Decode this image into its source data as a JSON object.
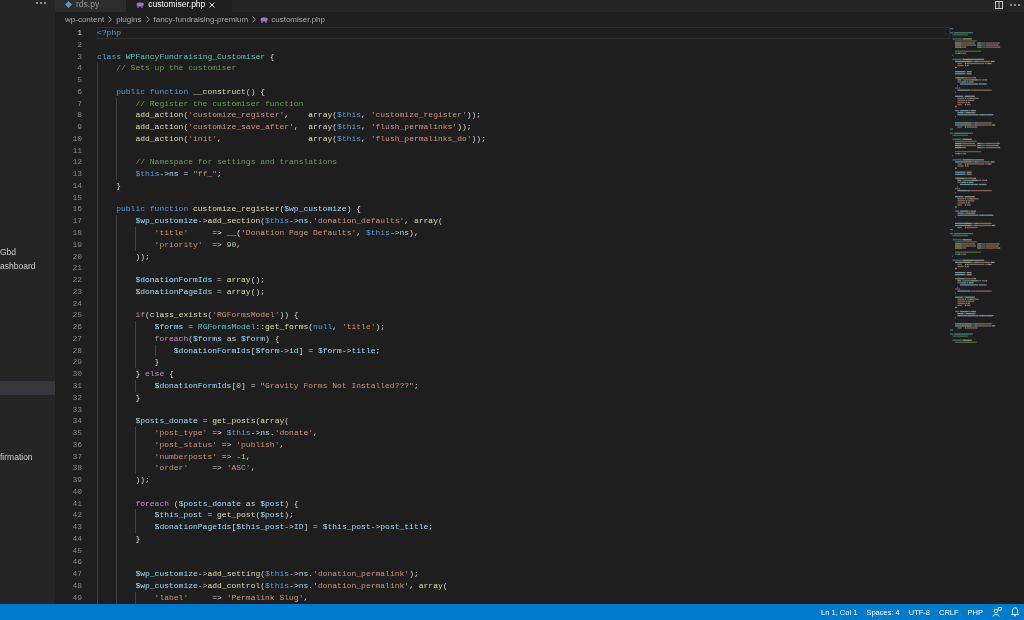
{
  "sidebar": {
    "items": [
      {
        "label": "Gbd",
        "selected": false
      },
      {
        "label": "ashboard",
        "selected": false
      },
      {
        "selected": true
      },
      {
        "label": "firmation",
        "selected": false
      }
    ]
  },
  "tabs": [
    {
      "label": "rds.py",
      "kind": "python",
      "selected": false
    },
    {
      "label": "customiser.php",
      "kind": "php",
      "selected": true
    }
  ],
  "breadcrumbs": [
    {
      "label": "wp-content",
      "kind": "folder"
    },
    {
      "label": "plugins",
      "kind": "folder"
    },
    {
      "label": "fancy-fundraising-premium",
      "kind": "folder"
    },
    {
      "label": "customiser.php",
      "kind": "php"
    }
  ],
  "editor": {
    "lines": [
      {
        "number": "1",
        "active": true,
        "tokens": [
          {
            "kind": "keyword",
            "text": "<?php"
          }
        ]
      },
      {
        "number": "2",
        "active": false
      },
      {
        "number": "3",
        "active": false,
        "tokens": [
          {
            "kind": "keyword",
            "text": "class "
          },
          {
            "kind": "class",
            "text": "WPFancyFundraising_Customiser"
          },
          {
            "kind": "plain",
            "text": " {"
          }
        ]
      },
      {
        "number": "4",
        "active": false,
        "tokens": [
          {
            "kind": "comment",
            "text": "    // Sets up the customiser"
          }
        ]
      },
      {
        "number": "5",
        "active": false
      },
      {
        "number": "6",
        "active": false,
        "tokens": [
          {
            "kind": "keyword",
            "text": "    public function "
          },
          {
            "kind": "function",
            "text": "__construct"
          },
          {
            "kind": "plain",
            "text": "() {"
          }
        ]
      },
      {
        "number": "7",
        "active": false,
        "tokens": [
          {
            "kind": "comment",
            "text": "        // Register the customiser function"
          }
        ]
      },
      {
        "number": "8",
        "active": false,
        "tokens": [
          {
            "kind": "function",
            "text": "        add_action"
          },
          {
            "kind": "plain",
            "text": "("
          },
          {
            "kind": "string",
            "text": "'customize_register'"
          },
          {
            "kind": "plain",
            "text": ",    "
          },
          {
            "kind": "function",
            "text": "array"
          },
          {
            "kind": "plain",
            "text": "("
          },
          {
            "kind": "keyword",
            "text": "$this"
          },
          {
            "kind": "plain",
            "text": ", "
          },
          {
            "kind": "string",
            "text": "'customize_register'"
          },
          {
            "kind": "plain",
            "text": "));"
          }
        ]
      },
      {
        "number": "9",
        "active": false,
        "tokens": [
          {
            "kind": "function",
            "text": "        add_action"
          },
          {
            "kind": "plain",
            "text": "("
          },
          {
            "kind": "string",
            "text": "'customize_save_after'"
          },
          {
            "kind": "plain",
            "text": ",  "
          },
          {
            "kind": "function",
            "text": "array"
          },
          {
            "kind": "plain",
            "text": "("
          },
          {
            "kind": "keyword",
            "text": "$this"
          },
          {
            "kind": "plain",
            "text": ", "
          },
          {
            "kind": "string",
            "text": "'flush_permalinks'"
          },
          {
            "kind": "plain",
            "text": "));"
          }
        ]
      },
      {
        "number": "10",
        "active": false,
        "tokens": [
          {
            "kind": "function",
            "text": "        add_action"
          },
          {
            "kind": "plain",
            "text": "("
          },
          {
            "kind": "string",
            "text": "'init'"
          },
          {
            "kind": "plain",
            "text": ",                  "
          },
          {
            "kind": "function",
            "text": "array"
          },
          {
            "kind": "plain",
            "text": "("
          },
          {
            "kind": "keyword",
            "text": "$this"
          },
          {
            "kind": "plain",
            "text": ", "
          },
          {
            "kind": "string",
            "text": "'flush_permalinks_do'"
          },
          {
            "kind": "plain",
            "text": "));"
          }
        ]
      },
      {
        "number": "11",
        "active": false
      },
      {
        "number": "12",
        "active": false,
        "tokens": [
          {
            "kind": "comment",
            "text": "        // Namespace for settings and translations"
          }
        ]
      },
      {
        "number": "13",
        "active": false,
        "tokens": [
          {
            "kind": "keyword",
            "text": "        $this"
          },
          {
            "kind": "plain",
            "text": "->"
          },
          {
            "kind": "variable",
            "text": "ns"
          },
          {
            "kind": "plain",
            "text": " = "
          },
          {
            "kind": "string",
            "text": "\"ff_\""
          },
          {
            "kind": "plain",
            "text": ";"
          }
        ]
      },
      {
        "number": "14",
        "active": false,
        "tokens": [
          {
            "kind": "plain",
            "text": "    }"
          }
        ]
      },
      {
        "number": "15",
        "active": false
      },
      {
        "number": "16",
        "active": false,
        "tokens": [
          {
            "kind": "keyword",
            "text": "    public function "
          },
          {
            "kind": "function",
            "text": "customize_register"
          },
          {
            "kind": "plain",
            "text": "("
          },
          {
            "kind": "variable",
            "text": "$wp_customize"
          },
          {
            "kind": "plain",
            "text": ") {"
          }
        ]
      },
      {
        "number": "17",
        "active": false,
        "tokens": [
          {
            "kind": "variable",
            "text": "        $wp_customize"
          },
          {
            "kind": "plain",
            "text": "->"
          },
          {
            "kind": "function",
            "text": "add_section"
          },
          {
            "kind": "plain",
            "text": "("
          },
          {
            "kind": "keyword",
            "text": "$this"
          },
          {
            "kind": "plain",
            "text": "->"
          },
          {
            "kind": "variable",
            "text": "ns"
          },
          {
            "kind": "plain",
            "text": "."
          },
          {
            "kind": "string",
            "text": "'donation_defaults'"
          },
          {
            "kind": "plain",
            "text": ", "
          },
          {
            "kind": "function",
            "text": "array"
          },
          {
            "kind": "plain",
            "text": "("
          }
        ]
      },
      {
        "number": "18",
        "active": false,
        "tokens": [
          {
            "kind": "string",
            "text": "            'title'"
          },
          {
            "kind": "plain",
            "text": "     => "
          },
          {
            "kind": "function",
            "text": "__"
          },
          {
            "kind": "plain",
            "text": "("
          },
          {
            "kind": "string",
            "text": "'Donation Page Defaults'"
          },
          {
            "kind": "plain",
            "text": ", "
          },
          {
            "kind": "keyword",
            "text": "$this"
          },
          {
            "kind": "plain",
            "text": "->"
          },
          {
            "kind": "variable",
            "text": "ns"
          },
          {
            "kind": "plain",
            "text": "),"
          }
        ]
      },
      {
        "number": "19",
        "active": false,
        "tokens": [
          {
            "kind": "string",
            "text": "            'priority'"
          },
          {
            "kind": "plain",
            "text": "  => "
          },
          {
            "kind": "number",
            "text": "90"
          },
          {
            "kind": "plain",
            "text": ","
          }
        ]
      },
      {
        "number": "20",
        "active": false,
        "tokens": [
          {
            "kind": "plain",
            "text": "        ));"
          }
        ]
      },
      {
        "number": "21",
        "active": false
      },
      {
        "number": "22",
        "active": false,
        "tokens": [
          {
            "kind": "variable",
            "text": "        $donationFormIds"
          },
          {
            "kind": "plain",
            "text": " = "
          },
          {
            "kind": "function",
            "text": "array"
          },
          {
            "kind": "plain",
            "text": "();"
          }
        ]
      },
      {
        "number": "23",
        "active": false,
        "tokens": [
          {
            "kind": "variable",
            "text": "        $donationPageIds"
          },
          {
            "kind": "plain",
            "text": " = "
          },
          {
            "kind": "function",
            "text": "array"
          },
          {
            "kind": "plain",
            "text": "();"
          }
        ]
      },
      {
        "number": "24",
        "active": false
      },
      {
        "number": "25",
        "active": false,
        "tokens": [
          {
            "kind": "control",
            "text": "        if"
          },
          {
            "kind": "plain",
            "text": "("
          },
          {
            "kind": "function",
            "text": "class_exists"
          },
          {
            "kind": "plain",
            "text": "("
          },
          {
            "kind": "string",
            "text": "'RGFormsModel'"
          },
          {
            "kind": "plain",
            "text": ")) {"
          }
        ]
      },
      {
        "number": "26",
        "active": false,
        "tokens": [
          {
            "kind": "variable",
            "text": "            $forms"
          },
          {
            "kind": "plain",
            "text": " = "
          },
          {
            "kind": "class",
            "text": "RGFormsModel"
          },
          {
            "kind": "plain",
            "text": "::"
          },
          {
            "kind": "function",
            "text": "get_forms"
          },
          {
            "kind": "plain",
            "text": "("
          },
          {
            "kind": "keyword",
            "text": "null"
          },
          {
            "kind": "plain",
            "text": ", "
          },
          {
            "kind": "string",
            "text": "'title'"
          },
          {
            "kind": "plain",
            "text": ");"
          }
        ]
      },
      {
        "number": "27",
        "active": false,
        "tokens": [
          {
            "kind": "control",
            "text": "            foreach"
          },
          {
            "kind": "plain",
            "text": "("
          },
          {
            "kind": "variable",
            "text": "$forms"
          },
          {
            "kind": "plain",
            "text": " as "
          },
          {
            "kind": "variable",
            "text": "$form"
          },
          {
            "kind": "plain",
            "text": ") {"
          }
        ]
      },
      {
        "number": "28",
        "active": false,
        "tokens": [
          {
            "kind": "variable",
            "text": "                $donationFormIds"
          },
          {
            "kind": "plain",
            "text": "["
          },
          {
            "kind": "variable",
            "text": "$form"
          },
          {
            "kind": "plain",
            "text": "->"
          },
          {
            "kind": "variable",
            "text": "id"
          },
          {
            "kind": "plain",
            "text": "] = "
          },
          {
            "kind": "variable",
            "text": "$form"
          },
          {
            "kind": "plain",
            "text": "->"
          },
          {
            "kind": "variable",
            "text": "title"
          },
          {
            "kind": "plain",
            "text": ";"
          }
        ]
      },
      {
        "number": "29",
        "active": false,
        "tokens": [
          {
            "kind": "plain",
            "text": "            }"
          }
        ]
      },
      {
        "number": "30",
        "active": false,
        "tokens": [
          {
            "kind": "plain",
            "text": "        } "
          },
          {
            "kind": "control",
            "text": "else"
          },
          {
            "kind": "plain",
            "text": " {"
          }
        ]
      },
      {
        "number": "31",
        "active": false,
        "tokens": [
          {
            "kind": "variable",
            "text": "            $donationFormIds"
          },
          {
            "kind": "plain",
            "text": "["
          },
          {
            "kind": "number",
            "text": "0"
          },
          {
            "kind": "plain",
            "text": "] = "
          },
          {
            "kind": "string",
            "text": "\"Gravity Forms Not Installed???\""
          },
          {
            "kind": "plain",
            "text": ";"
          }
        ]
      },
      {
        "number": "32",
        "active": false,
        "tokens": [
          {
            "kind": "plain",
            "text": "        }"
          }
        ]
      },
      {
        "number": "33",
        "active": false
      },
      {
        "number": "34",
        "active": false,
        "tokens": [
          {
            "kind": "variable",
            "text": "        $posts_donate"
          },
          {
            "kind": "plain",
            "text": " = "
          },
          {
            "kind": "function",
            "text": "get_posts"
          },
          {
            "kind": "plain",
            "text": "("
          },
          {
            "kind": "function",
            "text": "array"
          },
          {
            "kind": "plain",
            "text": "("
          }
        ]
      },
      {
        "number": "35",
        "active": false,
        "tokens": [
          {
            "kind": "string",
            "text": "            'post_type'"
          },
          {
            "kind": "plain",
            "text": " => "
          },
          {
            "kind": "keyword",
            "text": "$this"
          },
          {
            "kind": "plain",
            "text": "->"
          },
          {
            "kind": "variable",
            "text": "ns"
          },
          {
            "kind": "plain",
            "text": "."
          },
          {
            "kind": "string",
            "text": "'donate'"
          },
          {
            "kind": "plain",
            "text": ","
          }
        ]
      },
      {
        "number": "36",
        "active": false,
        "tokens": [
          {
            "kind": "string",
            "text": "            'post_status'"
          },
          {
            "kind": "plain",
            "text": " => "
          },
          {
            "kind": "string",
            "text": "'publish'"
          },
          {
            "kind": "plain",
            "text": ","
          }
        ]
      },
      {
        "number": "37",
        "active": false,
        "tokens": [
          {
            "kind": "string",
            "text": "            'numberposts'"
          },
          {
            "kind": "plain",
            "text": " => "
          },
          {
            "kind": "number",
            "text": "-1"
          },
          {
            "kind": "plain",
            "text": ","
          }
        ]
      },
      {
        "number": "38",
        "active": false,
        "tokens": [
          {
            "kind": "string",
            "text": "            'order'"
          },
          {
            "kind": "plain",
            "text": "     => "
          },
          {
            "kind": "string",
            "text": "'ASC'"
          },
          {
            "kind": "plain",
            "text": ","
          }
        ]
      },
      {
        "number": "39",
        "active": false,
        "tokens": [
          {
            "kind": "plain",
            "text": "        ));"
          }
        ]
      },
      {
        "number": "40",
        "active": false
      },
      {
        "number": "41",
        "active": false,
        "tokens": [
          {
            "kind": "control",
            "text": "        foreach"
          },
          {
            "kind": "plain",
            "text": " ("
          },
          {
            "kind": "variable",
            "text": "$posts_donate"
          },
          {
            "kind": "plain",
            "text": " as "
          },
          {
            "kind": "variable",
            "text": "$post"
          },
          {
            "kind": "plain",
            "text": ") {"
          }
        ]
      },
      {
        "number": "42",
        "active": false,
        "tokens": [
          {
            "kind": "variable",
            "text": "            $this_post"
          },
          {
            "kind": "plain",
            "text": " = "
          },
          {
            "kind": "function",
            "text": "get_post"
          },
          {
            "kind": "plain",
            "text": "("
          },
          {
            "kind": "variable",
            "text": "$post"
          },
          {
            "kind": "plain",
            "text": ");"
          }
        ]
      },
      {
        "number": "43",
        "active": false,
        "tokens": [
          {
            "kind": "variable",
            "text": "            $donationPageIds"
          },
          {
            "kind": "plain",
            "text": "["
          },
          {
            "kind": "variable",
            "text": "$this_post"
          },
          {
            "kind": "plain",
            "text": "->"
          },
          {
            "kind": "variable",
            "text": "ID"
          },
          {
            "kind": "plain",
            "text": "] = "
          },
          {
            "kind": "variable",
            "text": "$this_post"
          },
          {
            "kind": "plain",
            "text": "->"
          },
          {
            "kind": "variable",
            "text": "post_title"
          },
          {
            "kind": "plain",
            "text": ";"
          }
        ]
      },
      {
        "number": "44",
        "active": false,
        "tokens": [
          {
            "kind": "plain",
            "text": "        }"
          }
        ]
      },
      {
        "number": "45",
        "active": false
      },
      {
        "number": "46",
        "active": false
      },
      {
        "number": "47",
        "active": false,
        "tokens": [
          {
            "kind": "variable",
            "text": "        $wp_customize"
          },
          {
            "kind": "plain",
            "text": "->"
          },
          {
            "kind": "function",
            "text": "add_setting"
          },
          {
            "kind": "plain",
            "text": "("
          },
          {
            "kind": "keyword",
            "text": "$this"
          },
          {
            "kind": "plain",
            "text": "->"
          },
          {
            "kind": "variable",
            "text": "ns"
          },
          {
            "kind": "plain",
            "text": "."
          },
          {
            "kind": "string",
            "text": "'donation_permalink'"
          },
          {
            "kind": "plain",
            "text": ");"
          }
        ]
      },
      {
        "number": "48",
        "active": false,
        "tokens": [
          {
            "kind": "variable",
            "text": "        $wp_customize"
          },
          {
            "kind": "plain",
            "text": "->"
          },
          {
            "kind": "function",
            "text": "add_control"
          },
          {
            "kind": "plain",
            "text": "("
          },
          {
            "kind": "keyword",
            "text": "$this"
          },
          {
            "kind": "plain",
            "text": "->"
          },
          {
            "kind": "variable",
            "text": "ns"
          },
          {
            "kind": "plain",
            "text": "."
          },
          {
            "kind": "string",
            "text": "'donation_permalink'"
          },
          {
            "kind": "plain",
            "text": ", "
          },
          {
            "kind": "function",
            "text": "array"
          },
          {
            "kind": "plain",
            "text": "("
          }
        ]
      },
      {
        "number": "49",
        "active": false,
        "tokens": [
          {
            "kind": "string",
            "text": "            'label'"
          },
          {
            "kind": "plain",
            "text": "     => "
          },
          {
            "kind": "string",
            "text": "'Permalink Slug'"
          },
          {
            "kind": "plain",
            "text": ","
          }
        ]
      }
    ]
  },
  "status_bar": {
    "items": [
      "Ln 1, Col 1",
      "Spaces: 4",
      "UTF-8",
      "CRLF",
      "PHP"
    ]
  }
}
